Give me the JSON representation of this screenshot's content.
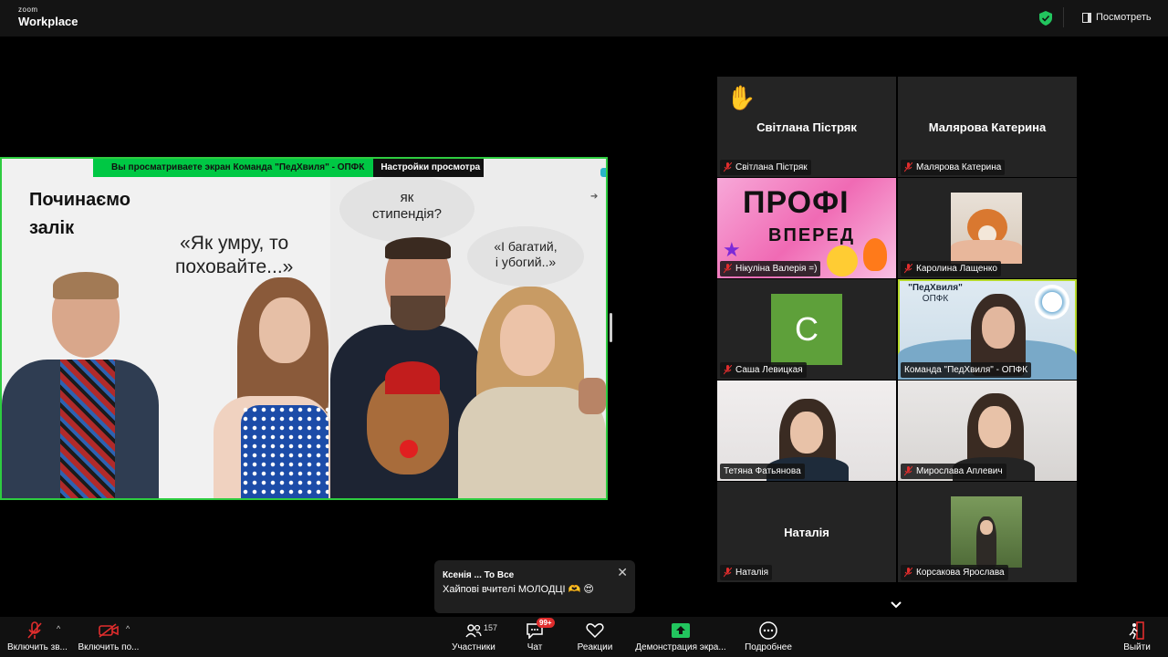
{
  "app": {
    "logo_small": "zoom",
    "logo_large": "Workplace",
    "view_button": "Посмотреть"
  },
  "share": {
    "banner_text": "Вы просматриваете экран  Команда \"ПедХвиля\" - ОПФК",
    "banner_settings": "Настройки просмотра",
    "slide_title_l1": "Починаємо",
    "slide_title_l2": "залік",
    "quote1_l1": "«Як умру, то",
    "quote1_l2": "поховайте...»",
    "bubble1_l1": "як",
    "bubble1_l2": "стипендія?",
    "bubble2_l1": "«І багатий,",
    "bubble2_l2": "і убогий..»"
  },
  "gallery": {
    "tiles": [
      {
        "center_name": "Світлана Пістряк",
        "label": "Світлана Пістряк",
        "hand": "✋"
      },
      {
        "center_name": "Малярова Катерина",
        "label": "Малярова Катерина"
      },
      {
        "label": "Нікуліна Валерія =)",
        "profi_l1": "ПРОФІ",
        "profi_l2": "ВПЕРЕД"
      },
      {
        "label": "Каролина Лащенко"
      },
      {
        "label": "Саша Левицкая",
        "avatar_letter": "C",
        "avatar_color": "#5ea03a"
      },
      {
        "label": "Команда \"ПедХвиля\" - ОПФК",
        "team_l1": "\"ПедХвиля\"",
        "team_l2": "ОПФК"
      },
      {
        "label": "Тетяна Фатьянова"
      },
      {
        "label": "Мирослава Аплевич"
      },
      {
        "center_name": "Наталія",
        "label": "Наталія"
      },
      {
        "label": "Корсакова Ярослава"
      }
    ]
  },
  "chat_toast": {
    "from": "Ксенія ... To Все",
    "message": "Хайпові вчителі МОЛОДЦІ 🫶 😍",
    "close": "✕"
  },
  "toolbar": {
    "audio": "Включить зв...",
    "video": "Включить по...",
    "participants": "Участники",
    "participants_count": "157",
    "chat": "Чат",
    "chat_badge": "99+",
    "reactions": "Реакции",
    "share": "Демонстрация экра...",
    "more": "Подробнее",
    "leave": "Выйти"
  },
  "colors": {
    "accent_green": "#00c844",
    "share_border": "#2ecc40",
    "active_speaker": "#b6d82b",
    "muted_red": "#e02d2d"
  }
}
